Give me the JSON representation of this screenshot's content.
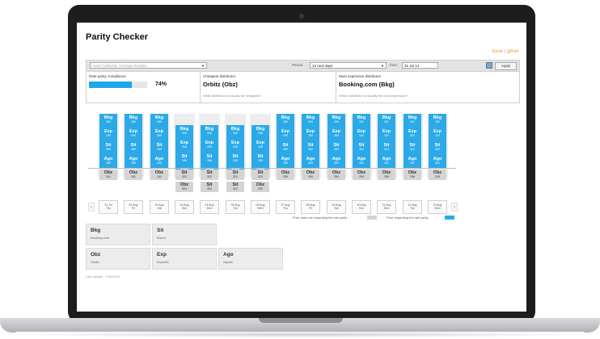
{
  "app": {
    "title": "Parity Checker"
  },
  "toolbar": {
    "export_label": "Excel",
    "sep": "|",
    "print_label": "Print"
  },
  "filter": {
    "property_value": "Hotel California, Cornaya Rosales",
    "period_label": "Period",
    "period_value": "14 next days",
    "from_label": "from",
    "from_value": "31 Jul 14",
    "apply_label": "Apply"
  },
  "kpis": {
    "compliance": {
      "caption": "Rate parity compliance",
      "value": 0.74,
      "label": "74%"
    },
    "cheapest": {
      "caption": "Cheapest distributor",
      "value": "Orbitz (Obz)",
      "question": "What distributor is usually the cheapest?"
    },
    "expensive": {
      "caption": "Most expensive distributor",
      "value": "Booking.com (Bkg)",
      "question": "Which distributor is usually the most expensive?"
    }
  },
  "columns": [
    {
      "date": "31 Jul",
      "day": "Thu",
      "respecting": true,
      "blue": [
        [
          "Bkg",
          "269"
        ],
        [
          "Exp",
          "269"
        ],
        [
          "Sit",
          "269"
        ],
        [
          "Ago",
          "269"
        ]
      ],
      "gray": [
        [
          "Obz",
          "241"
        ]
      ]
    },
    {
      "date": "01 Aug",
      "day": "Fri",
      "respecting": true,
      "blue": [
        [
          "Bkg",
          "269"
        ],
        [
          "Exp",
          "269"
        ],
        [
          "Sit",
          "269"
        ],
        [
          "Ago",
          "269"
        ]
      ],
      "gray": [
        [
          "Obz",
          "241"
        ]
      ]
    },
    {
      "date": "02 Aug",
      "day": "Sat",
      "respecting": true,
      "blue": [
        [
          "Bkg",
          "269"
        ],
        [
          "Exp",
          "269"
        ],
        [
          "Sit",
          "269"
        ],
        [
          "Ago",
          "269"
        ]
      ],
      "gray": [
        [
          "Obz",
          "241"
        ]
      ]
    },
    {
      "date": "03 Aug",
      "day": "Sun",
      "respecting": false,
      "blue": [
        [
          "Bkg",
          "336"
        ],
        [
          "Exp",
          "336"
        ],
        [
          "Sit",
          "336"
        ],
        [
          "Ago",
          "336"
        ]
      ],
      "gray": [
        [
          "Sit",
          "322"
        ],
        [
          "Obz",
          "304"
        ]
      ]
    },
    {
      "date": "04 Aug",
      "day": "Mon",
      "respecting": false,
      "blue": [
        [
          "Bkg",
          "336"
        ],
        [
          "Exp",
          "336"
        ],
        [
          "Sit",
          "336"
        ],
        [
          "Ago",
          "336"
        ]
      ],
      "gray": [
        [
          "Sit",
          "322"
        ],
        [
          "Sit",
          "322"
        ]
      ]
    },
    {
      "date": "05 Aug",
      "day": "Tue",
      "respecting": false,
      "blue": [
        [
          "Bkg",
          "336"
        ],
        [
          "Exp",
          "336"
        ],
        [
          "Sit",
          "336"
        ],
        [
          "Ago",
          "336"
        ]
      ],
      "gray": [
        [
          "Sit",
          "322"
        ],
        [
          "Sit",
          "322"
        ]
      ]
    },
    {
      "date": "06 Aug",
      "day": "Wed",
      "respecting": false,
      "blue": [
        [
          "Bkg",
          "336"
        ],
        [
          "Exp",
          "336"
        ],
        [
          "Sit",
          "336"
        ],
        [
          "Ago",
          "336"
        ]
      ],
      "gray": [
        [
          "Sit",
          "322"
        ],
        [
          "Obz",
          "259"
        ]
      ]
    },
    {
      "date": "07 Aug",
      "day": "Thu",
      "respecting": true,
      "blue": [
        [
          "Bkg",
          "269"
        ],
        [
          "Exp",
          "269"
        ],
        [
          "Sit",
          "269"
        ],
        [
          "Ago",
          "269"
        ]
      ],
      "gray": [
        [
          "Obz",
          "259"
        ]
      ]
    },
    {
      "date": "08 Aug",
      "day": "Fri",
      "respecting": true,
      "blue": [
        [
          "Bkg",
          "269"
        ],
        [
          "Exp",
          "269"
        ],
        [
          "Sit",
          "269"
        ],
        [
          "Ago",
          "269"
        ]
      ],
      "gray": [
        [
          "Obz",
          "259"
        ]
      ]
    },
    {
      "date": "09 Aug",
      "day": "Sat",
      "respecting": true,
      "blue": [
        [
          "Bkg",
          "269"
        ],
        [
          "Exp",
          "269"
        ],
        [
          "Sit",
          "269"
        ],
        [
          "Ago",
          "269"
        ]
      ],
      "gray": [
        [
          "Obz",
          "264"
        ]
      ]
    },
    {
      "date": "10 Aug",
      "day": "Sun",
      "respecting": true,
      "blue": [
        [
          "Bkg",
          "322"
        ],
        [
          "Exp",
          "322"
        ],
        [
          "Sit",
          "322"
        ],
        [
          "Ago",
          "322"
        ]
      ],
      "gray": [
        [
          "Obz",
          "294"
        ]
      ]
    },
    {
      "date": "11 Aug",
      "day": "Mon",
      "respecting": true,
      "blue": [
        [
          "Bkg",
          "322"
        ],
        [
          "Exp",
          "322"
        ],
        [
          "Sit",
          "322"
        ],
        [
          "Ago",
          "322"
        ]
      ],
      "gray": [
        [
          "Obz",
          "296"
        ]
      ]
    },
    {
      "date": "12 Aug",
      "day": "Tue",
      "respecting": true,
      "blue": [
        [
          "Bkg",
          "322"
        ],
        [
          "Exp",
          "322"
        ],
        [
          "Sit",
          "322"
        ],
        [
          "Ago",
          "322"
        ]
      ],
      "gray": [
        [
          "Obz",
          "296"
        ]
      ]
    },
    {
      "date": "13 Aug",
      "day": "Wed",
      "respecting": true,
      "blue": [
        [
          "Bkg",
          "322"
        ],
        [
          "Exp",
          "322"
        ],
        [
          "Sit",
          "322"
        ],
        [
          "Ago",
          "322"
        ]
      ],
      "gray": [
        [
          "Obz",
          "318"
        ]
      ]
    }
  ],
  "legend": {
    "not_respecting": "Price does not respecting the rate parity",
    "respecting": "Price respecting the rate parity",
    "not_respecting_color": "#d4d4d4",
    "respecting_color": "#2ba9e8"
  },
  "distributors": [
    {
      "code": "Bkg",
      "name": "Booking.com"
    },
    {
      "code": "Sit",
      "name": "Brand"
    },
    {
      "code": "Obz",
      "name": "Orbitz"
    },
    {
      "code": "Exp",
      "name": "Expedia"
    },
    {
      "code": "Ago",
      "name": "Agoda"
    }
  ],
  "footer": {
    "last_update": "Last update : 7/31/2014"
  },
  "colors": {
    "accent": "#2ba9e8",
    "export_link": "#e0892f"
  },
  "icons": [
    "laptop-camera-icon",
    "excel-icon",
    "print-icon",
    "calendar-icon",
    "chevron-left-icon",
    "chevron-right-icon",
    "chevron-down-icon"
  ]
}
